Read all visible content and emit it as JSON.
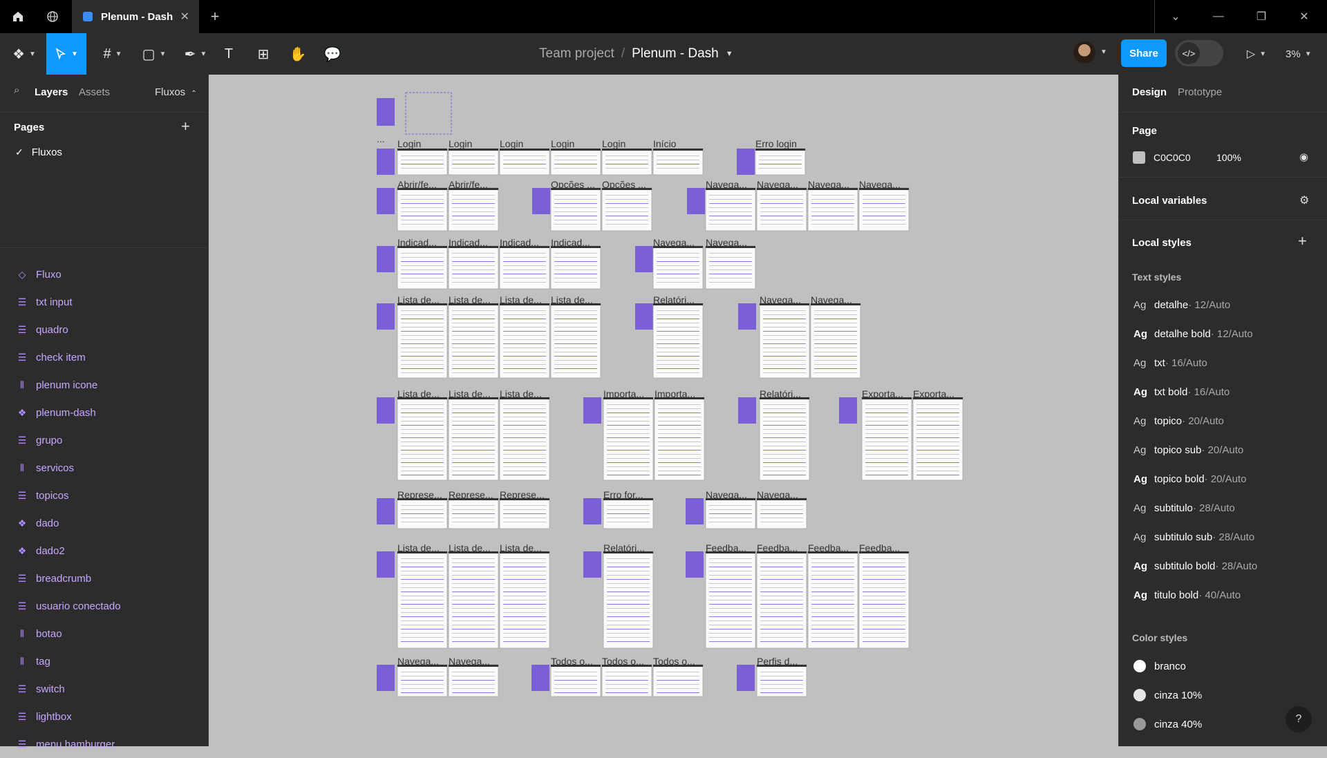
{
  "titlebar": {
    "tab_title": "Plenum - Dash"
  },
  "toolbar": {
    "breadcrumb_team": "Team project",
    "breadcrumb_sep": "/",
    "breadcrumb_file": "Plenum - Dash",
    "share_label": "Share",
    "zoom": "3%"
  },
  "left": {
    "tab_layers": "Layers",
    "tab_assets": "Assets",
    "page_switch": "Fluxos",
    "pages_title": "Pages",
    "current_page": "Fluxos",
    "layers": [
      {
        "label": "Fluxo",
        "icon": "diamond-icon"
      },
      {
        "label": "txt input",
        "icon": "lines-icon"
      },
      {
        "label": "quadro",
        "icon": "lines-icon"
      },
      {
        "label": "check item",
        "icon": "lines-icon"
      },
      {
        "label": "plenum icone",
        "icon": "columns-icon"
      },
      {
        "label": "plenum-dash",
        "icon": "component-icon"
      },
      {
        "label": "grupo",
        "icon": "lines-icon"
      },
      {
        "label": "servicos",
        "icon": "columns-icon"
      },
      {
        "label": "topicos",
        "icon": "lines-icon"
      },
      {
        "label": "dado",
        "icon": "component-icon"
      },
      {
        "label": "dado2",
        "icon": "component-icon"
      },
      {
        "label": "breadcrumb",
        "icon": "lines-icon"
      },
      {
        "label": "usuario conectado",
        "icon": "lines-icon"
      },
      {
        "label": "botao",
        "icon": "columns-icon"
      },
      {
        "label": "tag",
        "icon": "columns-icon"
      },
      {
        "label": "switch",
        "icon": "lines-icon"
      },
      {
        "label": "lightbox",
        "icon": "lines-icon"
      },
      {
        "label": "menu hamburger",
        "icon": "lines-icon"
      }
    ]
  },
  "right": {
    "tab_design": "Design",
    "tab_prototype": "Prototype",
    "page_title": "Page",
    "page_color": "C0C0C0",
    "page_opacity": "100%",
    "local_variables": "Local variables",
    "local_styles": "Local styles",
    "text_styles_title": "Text styles",
    "text_styles": [
      {
        "name": "detalhe",
        "meta": " · 12/Auto"
      },
      {
        "name": "detalhe bold",
        "meta": " · 12/Auto"
      },
      {
        "name": "txt",
        "meta": " · 16/Auto"
      },
      {
        "name": "txt bold",
        "meta": " · 16/Auto"
      },
      {
        "name": "topico",
        "meta": " · 20/Auto"
      },
      {
        "name": "topico sub",
        "meta": " · 20/Auto"
      },
      {
        "name": "topico bold",
        "meta": " · 20/Auto"
      },
      {
        "name": "subtitulo",
        "meta": " · 28/Auto"
      },
      {
        "name": "subtitulo sub",
        "meta": " · 28/Auto"
      },
      {
        "name": "subtitulo bold",
        "meta": " · 28/Auto"
      },
      {
        "name": "titulo bold",
        "meta": " · 40/Auto"
      }
    ],
    "ag": "Ag",
    "color_styles_title": "Color styles",
    "color_styles": [
      {
        "name": "branco",
        "color": "#ffffff"
      },
      {
        "name": "cinza 10%",
        "color": "#e6e6e6"
      },
      {
        "name": "cinza 40%",
        "color": "#999999"
      }
    ],
    "help": "?"
  },
  "canvas": {
    "frame_labels": [
      "Login",
      "Login",
      "Login",
      "Login",
      "Login",
      "Início",
      "Erro login",
      "Abrir/fe...",
      "Abrir/fe...",
      "Opções ...",
      "Opções ...",
      "Navega...",
      "Navega...",
      "Navega...",
      "Navega...",
      "Indicad...",
      "Indicad...",
      "Indicad...",
      "Indicad...",
      "Navega...",
      "Navega...",
      "Lista de...",
      "Lista de...",
      "Lista de...",
      "Lista de...",
      "Relatóri...",
      "Navega...",
      "Navega...",
      "Lista de...",
      "Lista de...",
      "Lista de...",
      "Importa...",
      "Importa...",
      "Relatóri...",
      "Exporta...",
      "Exporta...",
      "Represe...",
      "Represe...",
      "Represe...",
      "Erro for...",
      "Navega...",
      "Navega...",
      "Lista de...",
      "Lista de...",
      "Lista de...",
      "Relatóri...",
      "Feedba...",
      "Feedba...",
      "Feedba...",
      "Feedba...",
      "Navega...",
      "Navega...",
      "Todos o...",
      "Todos o...",
      "Todos o...",
      "Perfis d..."
    ],
    "top_dots": "..."
  },
  "colors": {
    "accent": "#0d99ff",
    "layer_purple": "#c9a7ff",
    "frame_purple": "#7a5fd6"
  }
}
